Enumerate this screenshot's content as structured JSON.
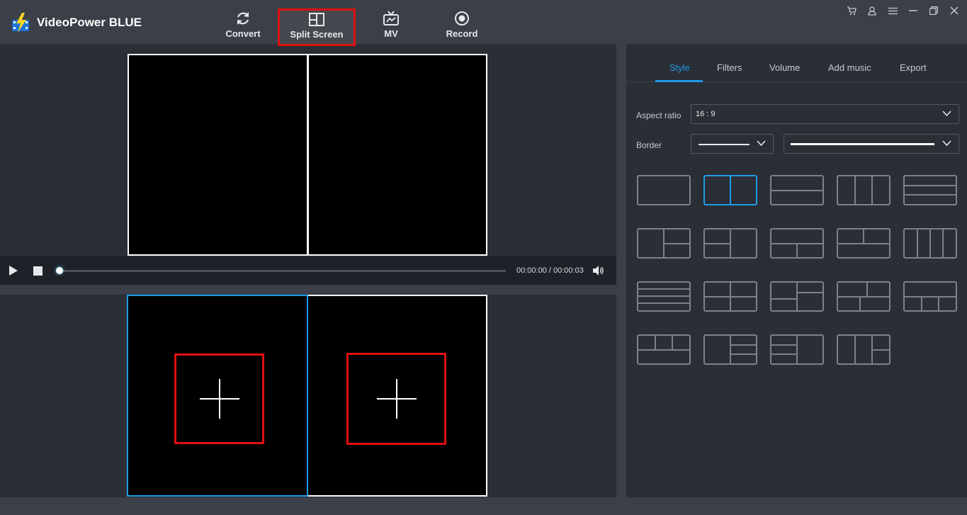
{
  "app": {
    "title": "VideoPower BLUE"
  },
  "nav": {
    "convert": "Convert",
    "split_screen": "Split Screen",
    "mv": "MV",
    "record": "Record"
  },
  "window_controls": [
    "cart-icon",
    "user-icon",
    "menu-icon",
    "minimize-icon",
    "restore-icon",
    "close-icon"
  ],
  "player": {
    "time": "00:00:00 / 00:00:03",
    "progress": 0
  },
  "tabs": [
    {
      "label": "Style",
      "active": true
    },
    {
      "label": "Filters",
      "active": false
    },
    {
      "label": "Volume",
      "active": false
    },
    {
      "label": "Add music",
      "active": false
    },
    {
      "label": "Export",
      "active": false
    }
  ],
  "style": {
    "aspect_label": "Aspect ratio",
    "aspect_value": "16 : 9",
    "border_label": "Border"
  },
  "layouts": {
    "count": 19,
    "selected_index": 1
  },
  "colors": {
    "accent": "#1e9be8",
    "highlight": "#e01010",
    "bg": "#2a2e35",
    "panel": "#3a3f48"
  }
}
